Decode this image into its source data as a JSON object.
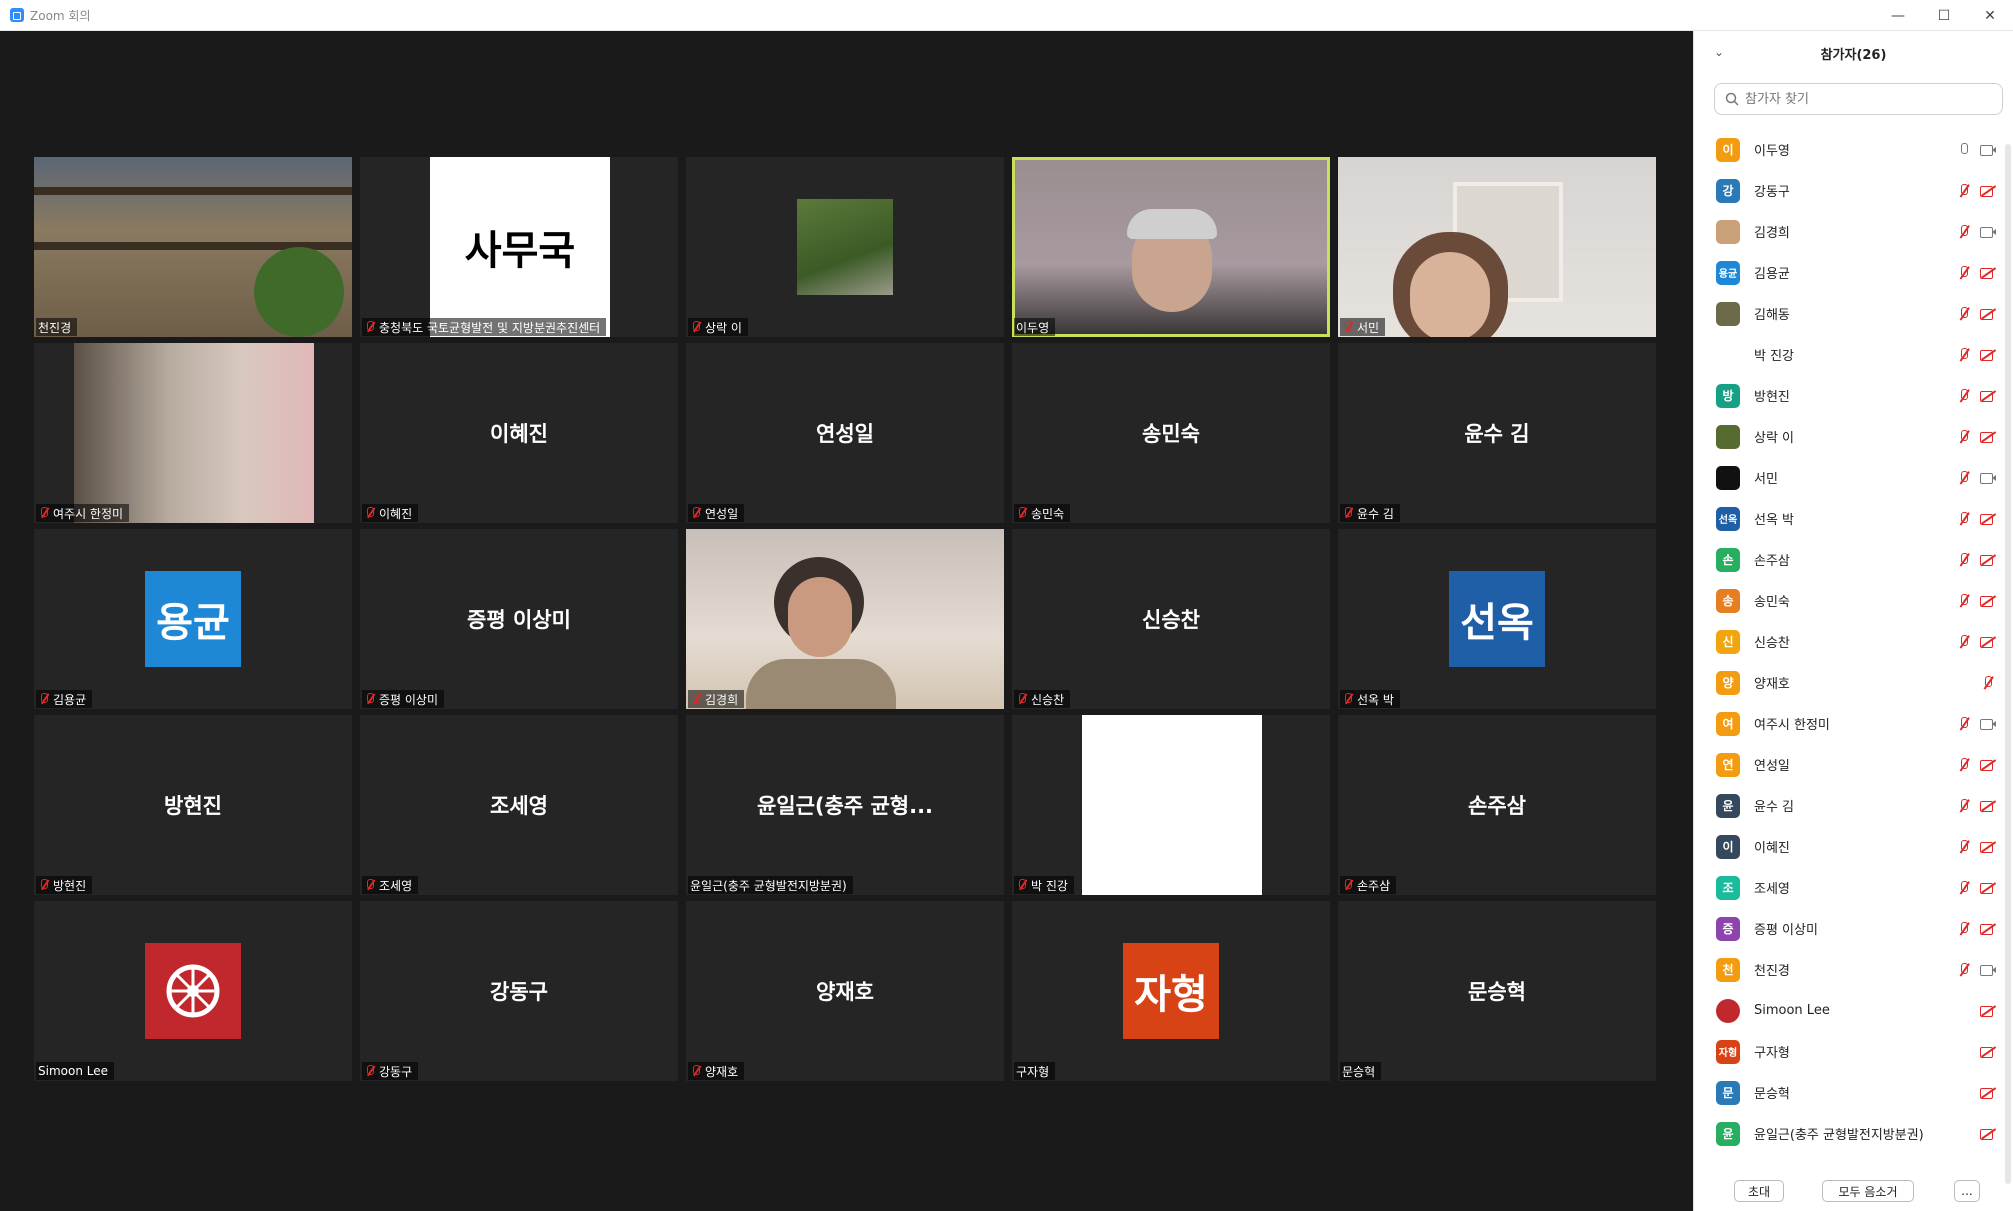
{
  "window": {
    "title": "Zoom 회의",
    "minimize": "—",
    "maximize": "☐",
    "close": "✕"
  },
  "tiles": [
    {
      "label": "천진경"
    },
    {
      "label": "충청북도 국토균형발전 및 지방분권추진센터",
      "sign_text": "사무국"
    },
    {
      "label": "상락 이"
    },
    {
      "label": "이두영"
    },
    {
      "label": "서민"
    },
    {
      "label": "여주시 한정미"
    },
    {
      "label": "이혜진",
      "name": "이혜진"
    },
    {
      "label": "연성일",
      "name": "연성일"
    },
    {
      "label": "송민숙",
      "name": "송민숙"
    },
    {
      "label": "윤수 김",
      "name": "윤수 김"
    },
    {
      "label": "김용균",
      "avatar_text": "용균"
    },
    {
      "label": "증평 이상미",
      "name": "증평 이상미"
    },
    {
      "label": "김경희"
    },
    {
      "label": "신승찬",
      "name": "신승찬"
    },
    {
      "label": "선옥 박",
      "avatar_text": "선옥"
    },
    {
      "label": "방현진",
      "name": "방현진"
    },
    {
      "label": "조세영",
      "name": "조세영"
    },
    {
      "label": "윤일근(충주 균형발전지방분권)",
      "name": "윤일근(충주 균형..."
    },
    {
      "label": "박 진강"
    },
    {
      "label": "손주삼",
      "name": "손주삼"
    },
    {
      "label": "Simoon Lee"
    },
    {
      "label": "강동구",
      "name": "강동구"
    },
    {
      "label": "양재호",
      "name": "양재호"
    },
    {
      "label": "구자형",
      "avatar_text": "자형"
    },
    {
      "label": "문승혁",
      "name": "문승혁"
    }
  ],
  "panel": {
    "title": "참가자(26)",
    "search_placeholder": "참가자 찾기",
    "participants": [
      {
        "initial": "이",
        "name": "이두영",
        "color": "#f39c12"
      },
      {
        "initial": "강",
        "name": "강동구",
        "color": "#2a7ab8"
      },
      {
        "initial": "",
        "name": "김경희",
        "color": "#c9a27a"
      },
      {
        "initial": "용균",
        "name": "김용균",
        "color": "#1e88d6"
      },
      {
        "initial": "",
        "name": "김해동",
        "color": "#6b6b4a"
      },
      {
        "initial": "",
        "name": "박 진강",
        "color": "#ffffff"
      },
      {
        "initial": "방",
        "name": "방현진",
        "color": "#16a085"
      },
      {
        "initial": "",
        "name": "상락 이",
        "color": "#556b2f"
      },
      {
        "initial": "",
        "name": "서민",
        "color": "#111111"
      },
      {
        "initial": "선옥",
        "name": "선옥 박",
        "color": "#1f5fa8"
      },
      {
        "initial": "손",
        "name": "손주삼",
        "color": "#27ae60"
      },
      {
        "initial": "송",
        "name": "송민숙",
        "color": "#e67e22"
      },
      {
        "initial": "신",
        "name": "신승찬",
        "color": "#f1a60f"
      },
      {
        "initial": "양",
        "name": "양재호",
        "color": "#f39c12"
      },
      {
        "initial": "여",
        "name": "여주시 한정미",
        "color": "#f39c12"
      },
      {
        "initial": "연",
        "name": "연성일",
        "color": "#f39c12"
      },
      {
        "initial": "윤",
        "name": "윤수 김",
        "color": "#34495e"
      },
      {
        "initial": "이",
        "name": "이혜진",
        "color": "#34495e"
      },
      {
        "initial": "조",
        "name": "조세영",
        "color": "#1abc9c"
      },
      {
        "initial": "증",
        "name": "증평 이상미",
        "color": "#8e44ad"
      },
      {
        "initial": "천",
        "name": "천진경",
        "color": "#f39c12"
      },
      {
        "initial": "",
        "name": "Simoon Lee",
        "color": "#c0282d"
      },
      {
        "initial": "자형",
        "name": "구자형",
        "color": "#d84315"
      },
      {
        "initial": "문",
        "name": "문승혁",
        "color": "#2a7ab8"
      },
      {
        "initial": "윤",
        "name": "윤일근(충주 균형발전지방분권)",
        "color": "#27ae60"
      }
    ],
    "invite": "초대",
    "mute_all": "모두 음소거",
    "more": "..."
  },
  "colors": {
    "active_speaker": "#c8e05a",
    "muted": "#e02828",
    "tile_bg": "#252525",
    "stage_bg": "#1a1a1a"
  }
}
